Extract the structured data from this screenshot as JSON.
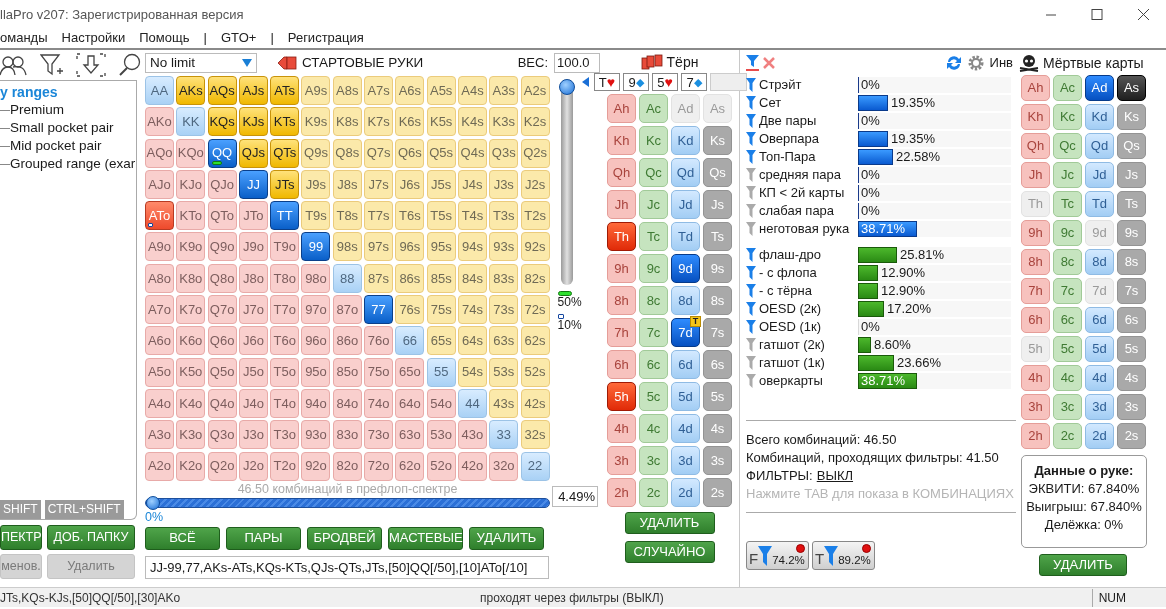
{
  "window": {
    "title": "llaPro v207: Зарегистрированная версия"
  },
  "menu": [
    "оманды",
    "Настройки",
    "Помощь",
    "|",
    "GTO+",
    "|",
    "Регистрация"
  ],
  "left_panel": {
    "tree": {
      "label": "y ranges",
      "children": [
        {
          "label": "Premium"
        },
        {
          "label": "Small pocket pair"
        },
        {
          "label": "Mid pocket pair"
        },
        {
          "label": "Grouped range (exar"
        }
      ]
    },
    "tabs": [
      {
        "label": "SHIFT",
        "selected": false
      },
      {
        "label": "CTRL+SHIFT",
        "selected": false
      }
    ],
    "buttons": [
      {
        "label": "ПЕКТР",
        "disabled": false
      },
      {
        "label": "ДОБ. ПАПКУ",
        "disabled": false
      },
      {
        "label": "менов.",
        "disabled": true
      },
      {
        "label": "Удалить",
        "disabled": true
      }
    ]
  },
  "range_editor": {
    "game": "No limit",
    "title": "СТАРТОВЫЕ РУКИ",
    "weight_label": "ВЕС:",
    "weight_value": "100.0",
    "grid": [
      [
        {
          "label": "AA",
          "selected": false
        },
        {
          "label": "AKs",
          "selected": true
        },
        {
          "label": "AQs",
          "selected": true
        },
        {
          "label": "AJs",
          "selected": true
        },
        {
          "label": "ATs",
          "selected": true
        },
        {
          "label": "A9s",
          "selected": false
        },
        {
          "label": "A8s",
          "selected": false
        },
        {
          "label": "A7s",
          "selected": false
        },
        {
          "label": "A6s",
          "selected": false
        },
        {
          "label": "A5s",
          "selected": false
        },
        {
          "label": "A4s",
          "selected": false
        },
        {
          "label": "A3s",
          "selected": false
        },
        {
          "label": "A2s",
          "selected": false
        }
      ],
      [
        {
          "label": "AKo",
          "selected": false
        },
        {
          "label": "KK",
          "selected": false
        },
        {
          "label": "KQs",
          "selected": true
        },
        {
          "label": "KJs",
          "selected": true
        },
        {
          "label": "KTs",
          "selected": true
        },
        {
          "label": "K9s",
          "selected": false
        },
        {
          "label": "K8s",
          "selected": false
        },
        {
          "label": "K7s",
          "selected": false
        },
        {
          "label": "K6s",
          "selected": false
        },
        {
          "label": "K5s",
          "selected": false
        },
        {
          "label": "K4s",
          "selected": false
        },
        {
          "label": "K3s",
          "selected": false
        },
        {
          "label": "K2s",
          "selected": false
        }
      ],
      [
        {
          "label": "AQo",
          "selected": false
        },
        {
          "label": "KQo",
          "selected": false
        },
        {
          "label": "QQ",
          "selected": true,
          "weight_50": true
        },
        {
          "label": "QJs",
          "selected": true
        },
        {
          "label": "QTs",
          "selected": true
        },
        {
          "label": "Q9s",
          "selected": false
        },
        {
          "label": "Q8s",
          "selected": false
        },
        {
          "label": "Q7s",
          "selected": false
        },
        {
          "label": "Q6s",
          "selected": false
        },
        {
          "label": "Q5s",
          "selected": false
        },
        {
          "label": "Q4s",
          "selected": false
        },
        {
          "label": "Q3s",
          "selected": false
        },
        {
          "label": "Q2s",
          "selected": false
        }
      ],
      [
        {
          "label": "AJo",
          "selected": false
        },
        {
          "label": "KJo",
          "selected": false
        },
        {
          "label": "QJo",
          "selected": false
        },
        {
          "label": "JJ",
          "selected": true
        },
        {
          "label": "JTs",
          "selected": true
        },
        {
          "label": "J9s",
          "selected": false
        },
        {
          "label": "J8s",
          "selected": false
        },
        {
          "label": "J7s",
          "selected": false
        },
        {
          "label": "J6s",
          "selected": false
        },
        {
          "label": "J5s",
          "selected": false
        },
        {
          "label": "J4s",
          "selected": false
        },
        {
          "label": "J3s",
          "selected": false
        },
        {
          "label": "J2s",
          "selected": false
        }
      ],
      [
        {
          "label": "ATo",
          "selected": true,
          "weight_10": true
        },
        {
          "label": "KTo",
          "selected": false
        },
        {
          "label": "QTo",
          "selected": false
        },
        {
          "label": "JTo",
          "selected": false
        },
        {
          "label": "TT",
          "selected": true
        },
        {
          "label": "T9s",
          "selected": false
        },
        {
          "label": "T8s",
          "selected": false
        },
        {
          "label": "T7s",
          "selected": false
        },
        {
          "label": "T6s",
          "selected": false
        },
        {
          "label": "T5s",
          "selected": false
        },
        {
          "label": "T4s",
          "selected": false
        },
        {
          "label": "T3s",
          "selected": false
        },
        {
          "label": "T2s",
          "selected": false
        }
      ],
      [
        {
          "label": "A9o",
          "selected": false
        },
        {
          "label": "K9o",
          "selected": false
        },
        {
          "label": "Q9o",
          "selected": false
        },
        {
          "label": "J9o",
          "selected": false
        },
        {
          "label": "T9o",
          "selected": false
        },
        {
          "label": "99",
          "selected": true
        },
        {
          "label": "98s",
          "selected": false
        },
        {
          "label": "97s",
          "selected": false
        },
        {
          "label": "96s",
          "selected": false
        },
        {
          "label": "95s",
          "selected": false
        },
        {
          "label": "94s",
          "selected": false
        },
        {
          "label": "93s",
          "selected": false
        },
        {
          "label": "92s",
          "selected": false
        }
      ],
      [
        {
          "label": "A8o",
          "selected": false
        },
        {
          "label": "K8o",
          "selected": false
        },
        {
          "label": "Q8o",
          "selected": false
        },
        {
          "label": "J8o",
          "selected": false
        },
        {
          "label": "T8o",
          "selected": false
        },
        {
          "label": "98o",
          "selected": false
        },
        {
          "label": "88",
          "selected": false
        },
        {
          "label": "87s",
          "selected": false
        },
        {
          "label": "86s",
          "selected": false
        },
        {
          "label": "85s",
          "selected": false
        },
        {
          "label": "84s",
          "selected": false
        },
        {
          "label": "83s",
          "selected": false
        },
        {
          "label": "82s",
          "selected": false
        }
      ],
      [
        {
          "label": "A7o",
          "selected": false
        },
        {
          "label": "K7o",
          "selected": false
        },
        {
          "label": "Q7o",
          "selected": false
        },
        {
          "label": "J7o",
          "selected": false
        },
        {
          "label": "T7o",
          "selected": false
        },
        {
          "label": "97o",
          "selected": false
        },
        {
          "label": "87o",
          "selected": false
        },
        {
          "label": "77",
          "selected": true
        },
        {
          "label": "76s",
          "selected": false
        },
        {
          "label": "75s",
          "selected": false
        },
        {
          "label": "74s",
          "selected": false
        },
        {
          "label": "73s",
          "selected": false
        },
        {
          "label": "72s",
          "selected": false
        }
      ],
      [
        {
          "label": "A6o",
          "selected": false
        },
        {
          "label": "K6o",
          "selected": false
        },
        {
          "label": "Q6o",
          "selected": false
        },
        {
          "label": "J6o",
          "selected": false
        },
        {
          "label": "T6o",
          "selected": false
        },
        {
          "label": "96o",
          "selected": false
        },
        {
          "label": "86o",
          "selected": false
        },
        {
          "label": "76o",
          "selected": false
        },
        {
          "label": "66",
          "selected": false
        },
        {
          "label": "65s",
          "selected": false
        },
        {
          "label": "64s",
          "selected": false
        },
        {
          "label": "63s",
          "selected": false
        },
        {
          "label": "62s",
          "selected": false
        }
      ],
      [
        {
          "label": "A5o",
          "selected": false
        },
        {
          "label": "K5o",
          "selected": false
        },
        {
          "label": "Q5o",
          "selected": false
        },
        {
          "label": "J5o",
          "selected": false
        },
        {
          "label": "T5o",
          "selected": false
        },
        {
          "label": "95o",
          "selected": false
        },
        {
          "label": "85o",
          "selected": false
        },
        {
          "label": "75o",
          "selected": false
        },
        {
          "label": "65o",
          "selected": false
        },
        {
          "label": "55",
          "selected": false
        },
        {
          "label": "54s",
          "selected": false
        },
        {
          "label": "53s",
          "selected": false
        },
        {
          "label": "52s",
          "selected": false
        }
      ],
      [
        {
          "label": "A4o",
          "selected": false
        },
        {
          "label": "K4o",
          "selected": false
        },
        {
          "label": "Q4o",
          "selected": false
        },
        {
          "label": "J4o",
          "selected": false
        },
        {
          "label": "T4o",
          "selected": false
        },
        {
          "label": "94o",
          "selected": false
        },
        {
          "label": "84o",
          "selected": false
        },
        {
          "label": "74o",
          "selected": false
        },
        {
          "label": "64o",
          "selected": false
        },
        {
          "label": "54o",
          "selected": false
        },
        {
          "label": "44",
          "selected": false
        },
        {
          "label": "43s",
          "selected": false
        },
        {
          "label": "42s",
          "selected": false
        }
      ],
      [
        {
          "label": "A3o",
          "selected": false
        },
        {
          "label": "K3o",
          "selected": false
        },
        {
          "label": "Q3o",
          "selected": false
        },
        {
          "label": "J3o",
          "selected": false
        },
        {
          "label": "T3o",
          "selected": false
        },
        {
          "label": "93o",
          "selected": false
        },
        {
          "label": "83o",
          "selected": false
        },
        {
          "label": "73o",
          "selected": false
        },
        {
          "label": "63o",
          "selected": false
        },
        {
          "label": "53o",
          "selected": false
        },
        {
          "label": "43o",
          "selected": false
        },
        {
          "label": "33",
          "selected": false
        },
        {
          "label": "32s",
          "selected": false
        }
      ],
      [
        {
          "label": "A2o",
          "selected": false
        },
        {
          "label": "K2o",
          "selected": false
        },
        {
          "label": "Q2o",
          "selected": false
        },
        {
          "label": "J2o",
          "selected": false
        },
        {
          "label": "T2o",
          "selected": false
        },
        {
          "label": "92o",
          "selected": false
        },
        {
          "label": "82o",
          "selected": false
        },
        {
          "label": "72o",
          "selected": false
        },
        {
          "label": "62o",
          "selected": false
        },
        {
          "label": "52o",
          "selected": false
        },
        {
          "label": "42o",
          "selected": false
        },
        {
          "label": "32o",
          "selected": false
        },
        {
          "label": "22",
          "selected": false
        }
      ]
    ],
    "weight_slider": {
      "level": 1
    },
    "legend": [
      {
        "kind": "half",
        "label": "50%"
      },
      {
        "kind": "tenth",
        "label": "10%"
      }
    ],
    "summary": "46.50 комбинаций в префлоп-спектре",
    "range_slider": {
      "level": 0,
      "label": "0%"
    },
    "percent": "4.49%",
    "buttons": [
      "ВСЁ",
      "ПАРЫ",
      "БРОДВЕЙ",
      "МАСТЕВЫЕ",
      "УДАЛИТЬ"
    ],
    "range_text": "JJ-99,77,AKs-ATs,KQs-KTs,QJs-QTs,JTs,[50]QQ[/50],[10]ATo[/10]"
  },
  "board": {
    "title": "Тёрн",
    "slots": [
      {
        "kind": "hearts",
        "rank": "T",
        "suit": "♥"
      },
      {
        "kind": "diamonds",
        "rank": "9",
        "suit": "◆"
      },
      {
        "kind": "hearts",
        "rank": "5",
        "suit": "♥"
      },
      {
        "kind": "diamonds",
        "rank": "7",
        "suit": "◆"
      },
      {
        "kind": "empty"
      }
    ],
    "columns": [
      {
        "kind": "hearts",
        "cards": [
          {
            "label": "Ah",
            "selected": false,
            "disabled": false
          },
          {
            "label": "Kh",
            "selected": false,
            "disabled": false
          },
          {
            "label": "Qh",
            "selected": false,
            "disabled": false
          },
          {
            "label": "Jh",
            "selected": false,
            "disabled": false
          },
          {
            "label": "Th",
            "selected": true,
            "disabled": false
          },
          {
            "label": "9h",
            "selected": false,
            "disabled": false
          },
          {
            "label": "8h",
            "selected": false,
            "disabled": false
          },
          {
            "label": "7h",
            "selected": false,
            "disabled": false
          },
          {
            "label": "6h",
            "selected": false,
            "disabled": false
          },
          {
            "label": "5h",
            "selected": true,
            "disabled": false
          },
          {
            "label": "4h",
            "selected": false,
            "disabled": false
          },
          {
            "label": "3h",
            "selected": false,
            "disabled": false
          },
          {
            "label": "2h",
            "selected": false,
            "disabled": false
          }
        ]
      },
      {
        "kind": "clubs",
        "cards": [
          {
            "label": "Ac",
            "selected": false,
            "disabled": false
          },
          {
            "label": "Kc",
            "selected": false,
            "disabled": false
          },
          {
            "label": "Qc",
            "selected": false,
            "disabled": false
          },
          {
            "label": "Jc",
            "selected": false,
            "disabled": false
          },
          {
            "label": "Tc",
            "selected": false,
            "disabled": false
          },
          {
            "label": "9c",
            "selected": false,
            "disabled": false
          },
          {
            "label": "8c",
            "selected": false,
            "disabled": false
          },
          {
            "label": "7c",
            "selected": false,
            "disabled": false
          },
          {
            "label": "6c",
            "selected": false,
            "disabled": false
          },
          {
            "label": "5c",
            "selected": false,
            "disabled": false
          },
          {
            "label": "4c",
            "selected": false,
            "disabled": false
          },
          {
            "label": "3c",
            "selected": false,
            "disabled": false
          },
          {
            "label": "2c",
            "selected": false,
            "disabled": false
          }
        ]
      },
      {
        "kind": "diamonds",
        "cards": [
          {
            "label": "Ad",
            "selected": false,
            "disabled": true
          },
          {
            "label": "Kd",
            "selected": false,
            "disabled": false
          },
          {
            "label": "Qd",
            "selected": false,
            "disabled": false
          },
          {
            "label": "Jd",
            "selected": false,
            "disabled": false
          },
          {
            "label": "Td",
            "selected": false,
            "disabled": false
          },
          {
            "label": "9d",
            "selected": true,
            "disabled": false
          },
          {
            "label": "8d",
            "selected": false,
            "disabled": false
          },
          {
            "label": "7d",
            "selected": true,
            "disabled": false,
            "badge": "T"
          },
          {
            "label": "6d",
            "selected": false,
            "disabled": false
          },
          {
            "label": "5d",
            "selected": false,
            "disabled": false
          },
          {
            "label": "4d",
            "selected": false,
            "disabled": false
          },
          {
            "label": "3d",
            "selected": false,
            "disabled": false
          },
          {
            "label": "2d",
            "selected": false,
            "disabled": false
          }
        ]
      },
      {
        "kind": "spades",
        "cards": [
          {
            "label": "As",
            "selected": false,
            "disabled": true
          },
          {
            "label": "Ks",
            "selected": false,
            "disabled": false
          },
          {
            "label": "Qs",
            "selected": false,
            "disabled": false
          },
          {
            "label": "Js",
            "selected": false,
            "disabled": false
          },
          {
            "label": "Ts",
            "selected": false,
            "disabled": false
          },
          {
            "label": "9s",
            "selected": false,
            "disabled": false
          },
          {
            "label": "8s",
            "selected": false,
            "disabled": false
          },
          {
            "label": "7s",
            "selected": false,
            "disabled": false
          },
          {
            "label": "6s",
            "selected": false,
            "disabled": false
          },
          {
            "label": "5s",
            "selected": false,
            "disabled": false
          },
          {
            "label": "4s",
            "selected": false,
            "disabled": false
          },
          {
            "label": "3s",
            "selected": false,
            "disabled": false
          },
          {
            "label": "2s",
            "selected": false,
            "disabled": false
          }
        ]
      }
    ],
    "buttons": [
      "УДАЛИТЬ",
      "СЛУЧАЙНО"
    ]
  },
  "stats": {
    "invert_label": "Инв",
    "groups": [
      {
        "kind": "made",
        "rows": [
          {
            "label": "Стрэйт",
            "value": "0%",
            "level": 0,
            "filter_on": true
          },
          {
            "label": "Сет",
            "value": "19.35%",
            "level": 0.1935,
            "filter_on": true
          },
          {
            "label": "Две пары",
            "value": "0%",
            "level": 0,
            "filter_on": true
          },
          {
            "label": "Оверпара",
            "value": "19.35%",
            "level": 0.1935,
            "filter_on": true
          },
          {
            "label": "Топ-Пара",
            "value": "22.58%",
            "level": 0.2258,
            "filter_on": true
          },
          {
            "label": "средняя пара",
            "value": "0%",
            "level": 0,
            "filter_on": false
          },
          {
            "label": "КП < 2й карты",
            "value": "0%",
            "level": 0,
            "filter_on": false
          },
          {
            "label": "слабая пара",
            "value": "0%",
            "level": 0,
            "filter_on": false
          },
          {
            "label": "неготовая рука",
            "value": "38.71%",
            "level": 0.3871,
            "filter_on": false
          }
        ]
      },
      {
        "kind": "draws",
        "rows": [
          {
            "label": "флаш-дро",
            "value": "25.81%",
            "level": 0.2581,
            "filter_on": true
          },
          {
            "label": "- с флопа",
            "value": "12.90%",
            "level": 0.129,
            "filter_on": true
          },
          {
            "label": "- с тёрна",
            "value": "12.90%",
            "level": 0.129,
            "filter_on": true
          },
          {
            "label": "OESD (2к)",
            "value": "17.20%",
            "level": 0.172,
            "filter_on": true
          },
          {
            "label": "OESD (1к)",
            "value": "0%",
            "level": 0,
            "filter_on": true
          },
          {
            "label": "гатшот (2к)",
            "value": "8.60%",
            "level": 0.086,
            "filter_on": false
          },
          {
            "label": "гатшот (1к)",
            "value": "23.66%",
            "level": 0.2366,
            "filter_on": false
          },
          {
            "label": "оверкарты",
            "value": "38.71%",
            "level": 0.3871,
            "filter_on": false
          }
        ]
      }
    ],
    "total": "Всего комбинаций: 46.50",
    "passing": "Комбинаций, проходящих фильтры: 41.50",
    "filters_label": "ФИЛЬТРЫ:",
    "filters_value": "ВЫКЛ",
    "hint": "Нажмите TAB для показа в КОМБИНАЦИЯХ",
    "quick_filters": [
      {
        "letter": "F",
        "value": "74.2%",
        "alert": true
      },
      {
        "letter": "T",
        "value": "89.2%",
        "alert": true
      }
    ]
  },
  "dead_cards": {
    "title": "Мёртвые карты",
    "columns": [
      {
        "kind": "hearts",
        "cards": [
          {
            "label": "Ah",
            "selected": false,
            "disabled": false
          },
          {
            "label": "Kh",
            "selected": false,
            "disabled": false
          },
          {
            "label": "Qh",
            "selected": false,
            "disabled": false
          },
          {
            "label": "Jh",
            "selected": false,
            "disabled": false
          },
          {
            "label": "Th",
            "selected": false,
            "disabled": true
          },
          {
            "label": "9h",
            "selected": false,
            "disabled": false
          },
          {
            "label": "8h",
            "selected": false,
            "disabled": false
          },
          {
            "label": "7h",
            "selected": false,
            "disabled": false
          },
          {
            "label": "6h",
            "selected": false,
            "disabled": false
          },
          {
            "label": "5h",
            "selected": false,
            "disabled": true
          },
          {
            "label": "4h",
            "selected": false,
            "disabled": false
          },
          {
            "label": "3h",
            "selected": false,
            "disabled": false
          },
          {
            "label": "2h",
            "selected": false,
            "disabled": false
          }
        ]
      },
      {
        "kind": "clubs",
        "cards": [
          {
            "label": "Ac",
            "selected": false,
            "disabled": false
          },
          {
            "label": "Kc",
            "selected": false,
            "disabled": false
          },
          {
            "label": "Qc",
            "selected": false,
            "disabled": false
          },
          {
            "label": "Jc",
            "selected": false,
            "disabled": false
          },
          {
            "label": "Tc",
            "selected": false,
            "disabled": false
          },
          {
            "label": "9c",
            "selected": false,
            "disabled": false
          },
          {
            "label": "8c",
            "selected": false,
            "disabled": false
          },
          {
            "label": "7c",
            "selected": false,
            "disabled": false
          },
          {
            "label": "6c",
            "selected": false,
            "disabled": false
          },
          {
            "label": "5c",
            "selected": false,
            "disabled": false
          },
          {
            "label": "4c",
            "selected": false,
            "disabled": false
          },
          {
            "label": "3c",
            "selected": false,
            "disabled": false
          },
          {
            "label": "2c",
            "selected": false,
            "disabled": false
          }
        ]
      },
      {
        "kind": "diamonds",
        "cards": [
          {
            "label": "Ad",
            "selected": true,
            "disabled": false
          },
          {
            "label": "Kd",
            "selected": false,
            "disabled": false
          },
          {
            "label": "Qd",
            "selected": false,
            "disabled": false
          },
          {
            "label": "Jd",
            "selected": false,
            "disabled": false
          },
          {
            "label": "Td",
            "selected": false,
            "disabled": false
          },
          {
            "label": "9d",
            "selected": false,
            "disabled": true
          },
          {
            "label": "8d",
            "selected": false,
            "disabled": false
          },
          {
            "label": "7d",
            "selected": false,
            "disabled": true
          },
          {
            "label": "6d",
            "selected": false,
            "disabled": false
          },
          {
            "label": "5d",
            "selected": false,
            "disabled": false
          },
          {
            "label": "4d",
            "selected": false,
            "disabled": false
          },
          {
            "label": "3d",
            "selected": false,
            "disabled": false
          },
          {
            "label": "2d",
            "selected": false,
            "disabled": false
          }
        ]
      },
      {
        "kind": "spades",
        "cards": [
          {
            "label": "As",
            "selected": true,
            "disabled": false
          },
          {
            "label": "Ks",
            "selected": false,
            "disabled": false
          },
          {
            "label": "Qs",
            "selected": false,
            "disabled": false
          },
          {
            "label": "Js",
            "selected": false,
            "disabled": false
          },
          {
            "label": "Ts",
            "selected": false,
            "disabled": false
          },
          {
            "label": "9s",
            "selected": false,
            "disabled": false
          },
          {
            "label": "8s",
            "selected": false,
            "disabled": false
          },
          {
            "label": "7s",
            "selected": false,
            "disabled": false
          },
          {
            "label": "6s",
            "selected": false,
            "disabled": false
          },
          {
            "label": "5s",
            "selected": false,
            "disabled": false
          },
          {
            "label": "4s",
            "selected": false,
            "disabled": false
          },
          {
            "label": "3s",
            "selected": false,
            "disabled": false
          },
          {
            "label": "2s",
            "selected": false,
            "disabled": false
          }
        ]
      }
    ],
    "hand_info": {
      "title": "Данные о руке:",
      "lines": [
        "ЭКВИТИ: 67.840%",
        "Выигрыш: 67.840%",
        "Делёжка: 0%"
      ]
    },
    "button": "УДАЛИТЬ"
  },
  "status_bar": {
    "texts": [
      "JTs,KQs-KJs,[50]QQ[/50],[30]AKo",
      "проходят через фильтры (ВЫКЛ)"
    ],
    "indicator": "NUM"
  }
}
